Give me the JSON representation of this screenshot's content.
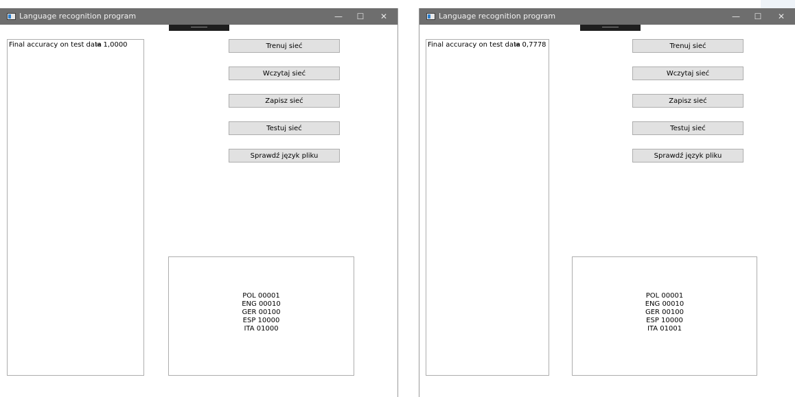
{
  "windows": [
    {
      "title": "Language recognition program",
      "controls": {
        "minimize": "—",
        "maximize": "☐",
        "close": "✕"
      },
      "accuracy_label": "Final accuracy on test data",
      "accuracy_value": "= 1,0000",
      "buttons": [
        "Trenuj sieć",
        "Wczytaj sieć",
        "Zapisz sieć",
        "Testuj sieć",
        "Sprawdź język pliku"
      ],
      "legend": [
        "POL 00001",
        "ENG 00010",
        "GER 00100",
        "ESP 10000",
        "ITA 01000"
      ]
    },
    {
      "title": "Language recognition program",
      "controls": {
        "minimize": "—",
        "maximize": "☐",
        "close": "✕"
      },
      "accuracy_label": "Final accuracy on test data",
      "accuracy_value": "= 0,7778",
      "buttons": [
        "Trenuj sieć",
        "Wczytaj sieć",
        "Zapisz sieć",
        "Testuj sieć",
        "Sprawdź język pliku"
      ],
      "legend": [
        "POL 00001",
        "ENG 00010",
        "GER 00100",
        "ESP 10000",
        "ITA 01001"
      ]
    }
  ],
  "colors": {
    "titlebar": "#6e6e6e",
    "button_bg": "#e1e1e1",
    "border": "#adadad",
    "grip": "#1e1e1e"
  },
  "icons": [
    "app-window-icon",
    "minimize-icon",
    "maximize-icon",
    "close-icon"
  ]
}
